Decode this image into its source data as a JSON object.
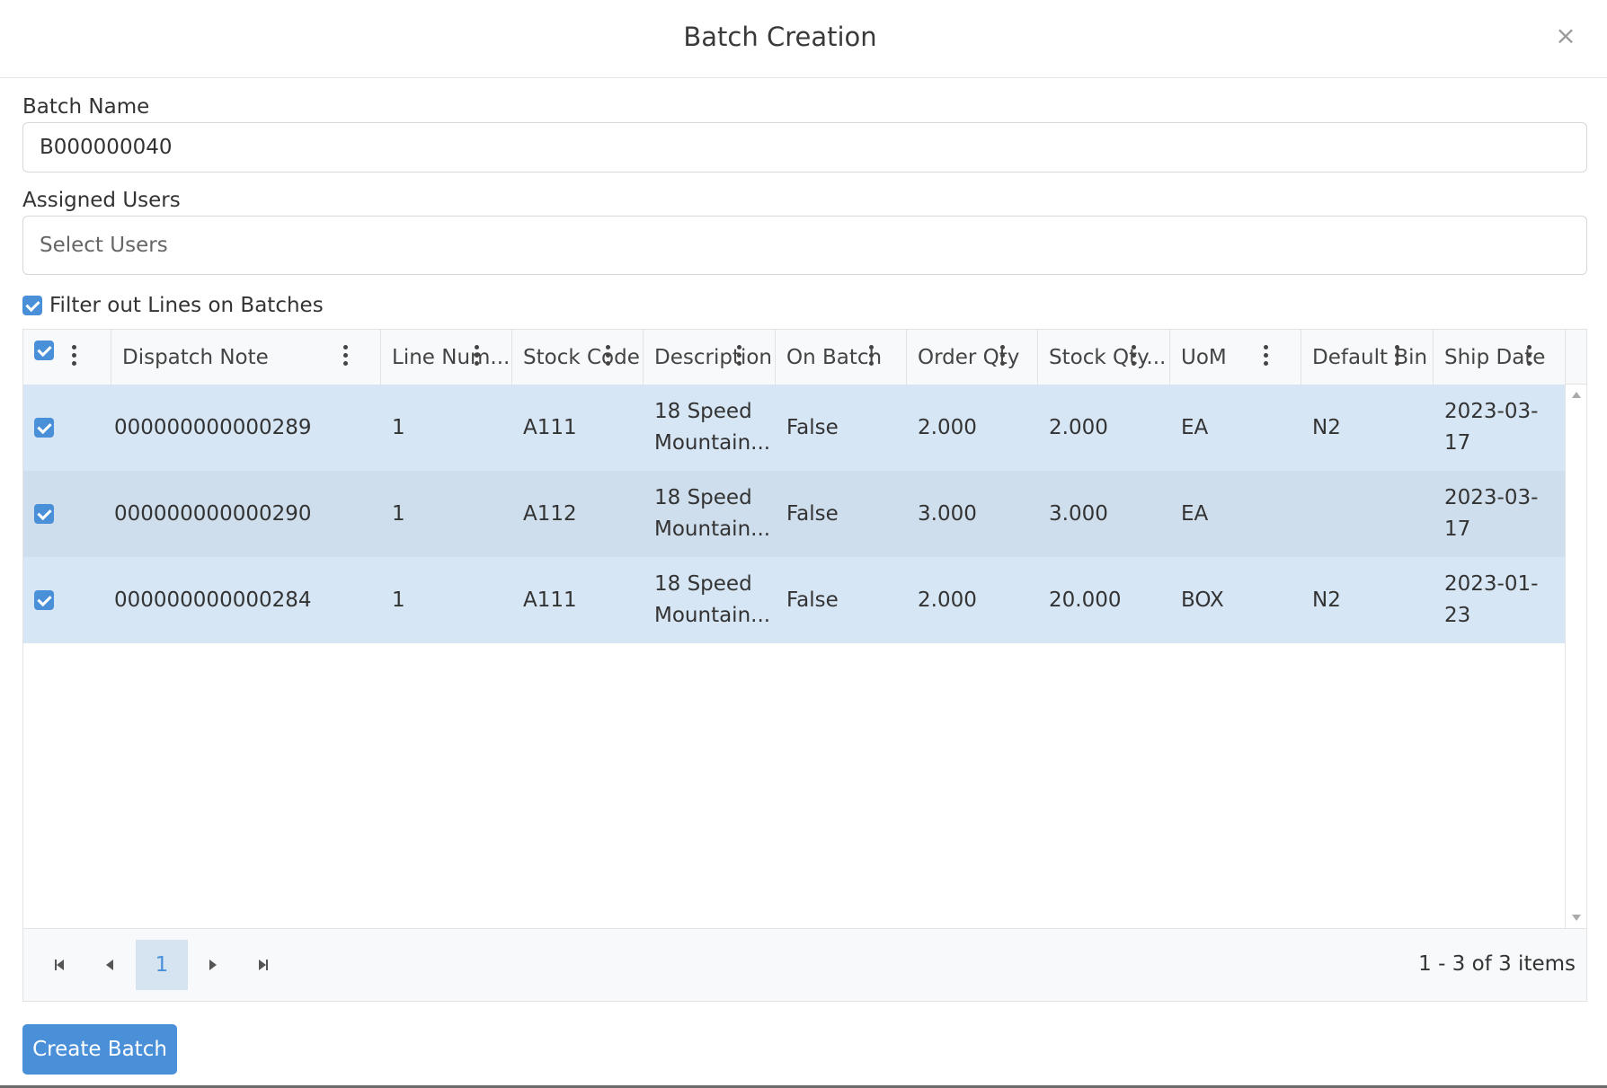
{
  "dialog": {
    "title": "Batch Creation",
    "close_glyph": "×"
  },
  "form": {
    "batch_name_label": "Batch Name",
    "batch_name_value": "B000000040",
    "assigned_users_label": "Assigned Users",
    "assigned_users_placeholder": "Select Users",
    "filter_label": "Filter out Lines on Batches",
    "filter_checked": true
  },
  "grid": {
    "columns": [
      "Dispatch Note",
      "Line Num...",
      "Stock Code",
      "Description",
      "On Batch",
      "Order Qty",
      "Stock Qty...",
      "UoM",
      "Default Bin",
      "Ship Date"
    ],
    "rows": [
      [
        "000000000000289",
        "1",
        "A111",
        "18 Speed Mountain...",
        "False",
        "2.000",
        "2.000",
        "EA",
        "N2",
        "2023-03-17"
      ],
      [
        "000000000000290",
        "1",
        "A112",
        "18 Speed Mountain...",
        "False",
        "3.000",
        "3.000",
        "EA",
        "",
        "2023-03-17"
      ],
      [
        "000000000000284",
        "1",
        "A111",
        "18 Speed Mountain...",
        "False",
        "2.000",
        "20.000",
        "BOX",
        "N2",
        "2023-01-23"
      ]
    ]
  },
  "pager": {
    "current_page": "1",
    "info": "1 - 3 of 3 items"
  },
  "actions": {
    "create_label": "Create Batch"
  },
  "colors": {
    "accent": "#4a90d9",
    "row_selected": "#d7e6f5",
    "row_selected_alt": "#cfdeec"
  }
}
